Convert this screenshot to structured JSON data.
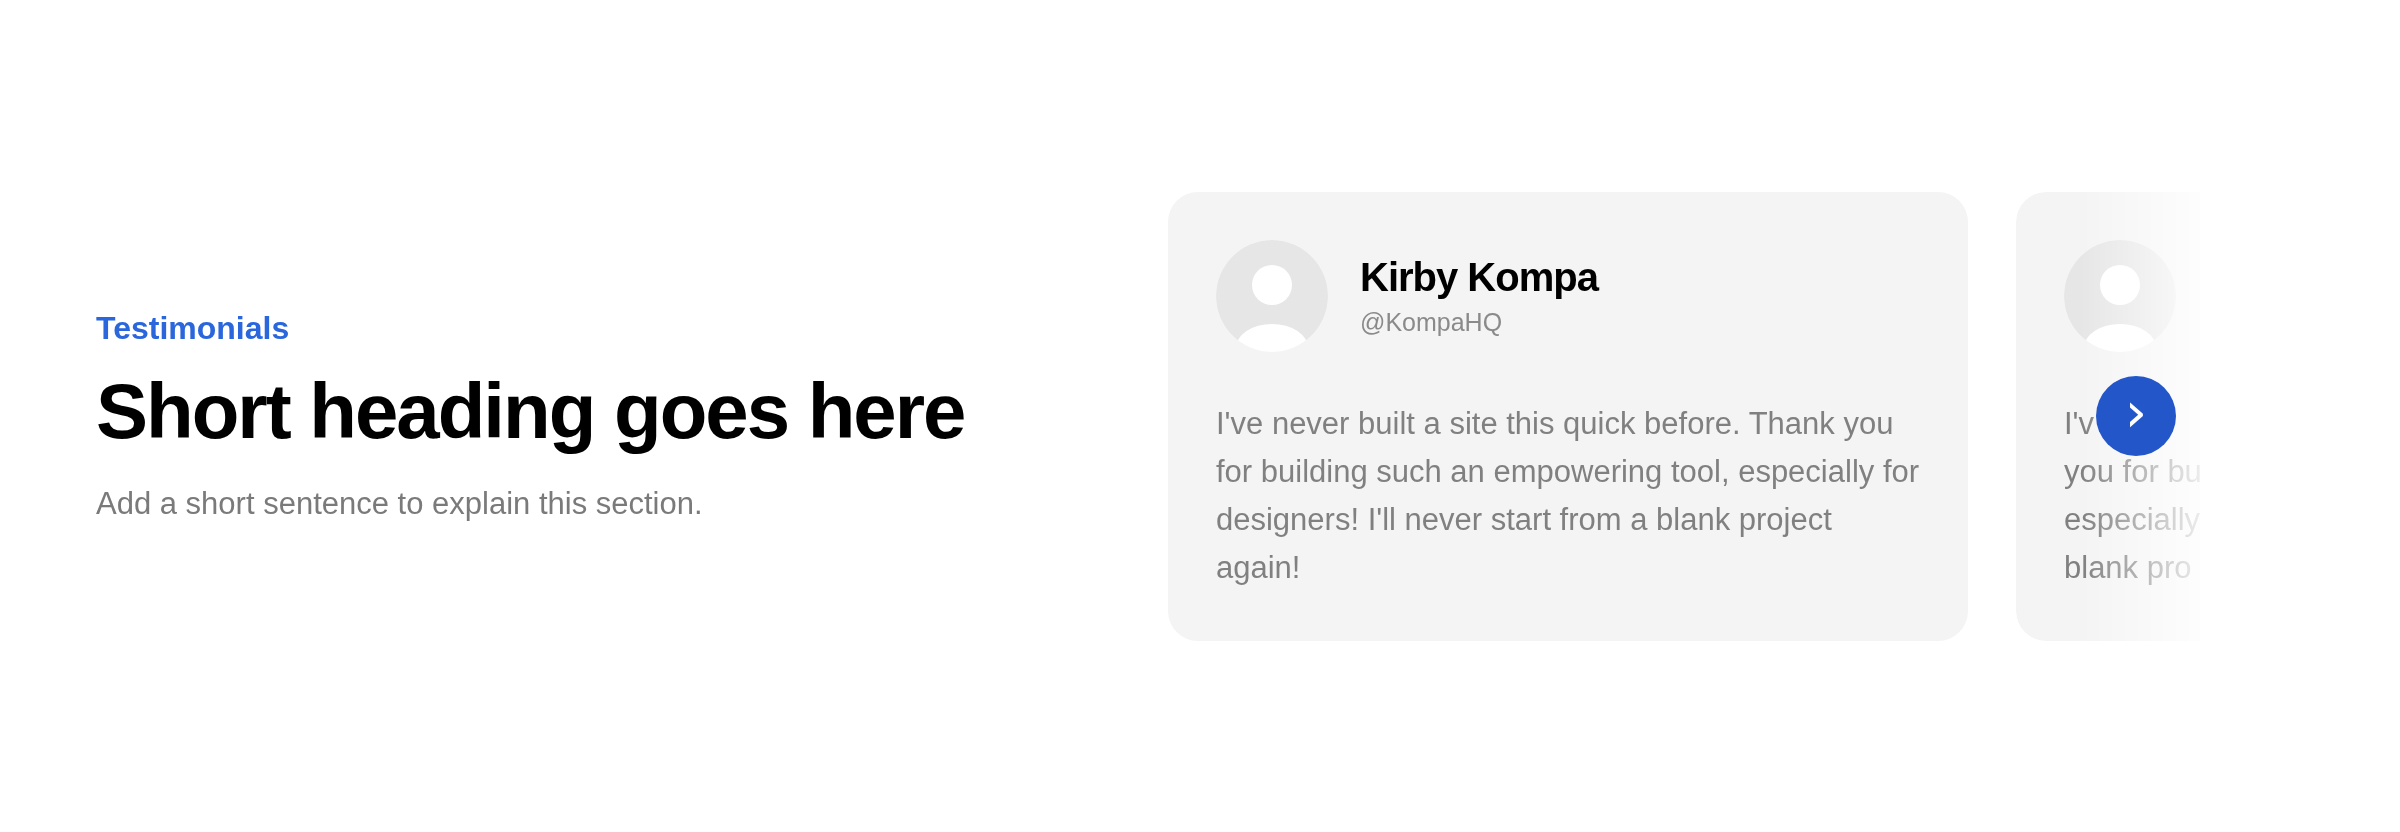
{
  "intro": {
    "eyebrow": "Testimonials",
    "heading": "Short heading goes here",
    "sentence": "Add a short sentence to explain this section."
  },
  "testimonials": [
    {
      "kind": "full",
      "name": "Kirby Kompa",
      "handle": "@KompaHQ",
      "quote": "I've never built a site this quick before. Thank you for building such an empowering tool, especially for designers! I'll never start from a blank project again!"
    },
    {
      "kind": "clipped",
      "quote_lines": [
        "I'v",
        "you for bu",
        "especially",
        "blank pro"
      ]
    }
  ],
  "next_button": {
    "label": "›"
  }
}
